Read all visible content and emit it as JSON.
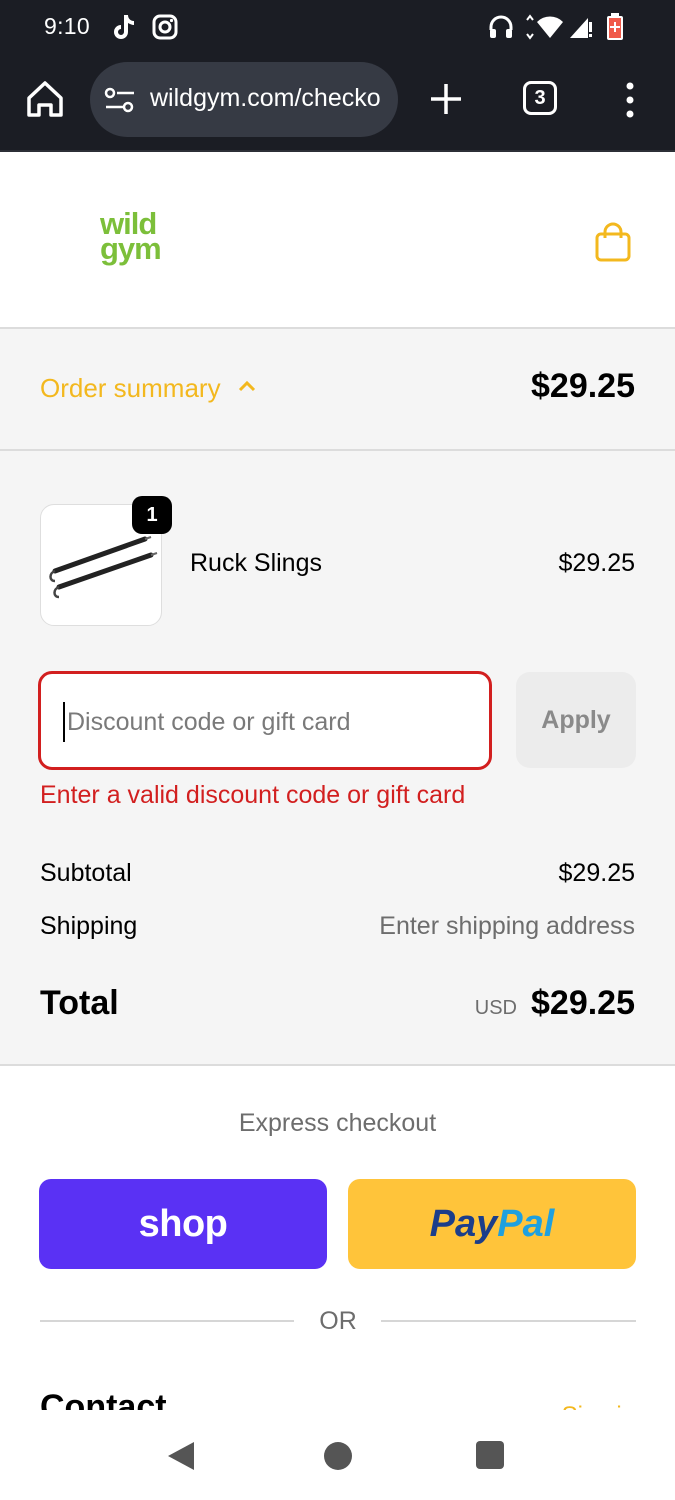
{
  "status_bar": {
    "time": "9:10",
    "left_icons": [
      "tiktok-icon",
      "instagram-icon"
    ],
    "right_icons": [
      "headset-icon",
      "wifi-icon",
      "signal-icon",
      "battery-icon"
    ]
  },
  "browser": {
    "url": "wildgym.com/checkout",
    "tab_count": "3",
    "icons": [
      "home-icon",
      "site-settings-icon",
      "new-tab-icon",
      "tabs-icon",
      "more-menu-icon"
    ]
  },
  "header": {
    "logo_line1": "wild",
    "logo_line2": "gym",
    "cart_icon": "shopping-bag-icon"
  },
  "order_summary": {
    "toggle_label": "Order summary",
    "total": "$29.25",
    "items": [
      {
        "name": "Ruck Slings",
        "price": "$29.25",
        "quantity": "1"
      }
    ],
    "discount": {
      "placeholder": "Discount code or gift card",
      "value": "",
      "apply_label": "Apply",
      "error": "Enter a valid discount code or gift card"
    },
    "subtotal_label": "Subtotal",
    "subtotal_value": "$29.25",
    "shipping_label": "Shipping",
    "shipping_value": "Enter shipping address",
    "total_label": "Total",
    "total_currency": "USD",
    "total_value": "$29.25"
  },
  "express": {
    "title": "Express checkout",
    "shop_label": "shop",
    "paypal_label_1": "Pay",
    "paypal_label_2": "Pal",
    "or_label": "OR"
  },
  "contact": {
    "heading": "Contact",
    "signin": "Sign in"
  },
  "colors": {
    "accent": "#f3b81e",
    "error": "#d21f1f",
    "logo_green": "#7cbf3a",
    "shop_purple": "#5a31f4",
    "paypal_yellow": "#ffc43a"
  }
}
